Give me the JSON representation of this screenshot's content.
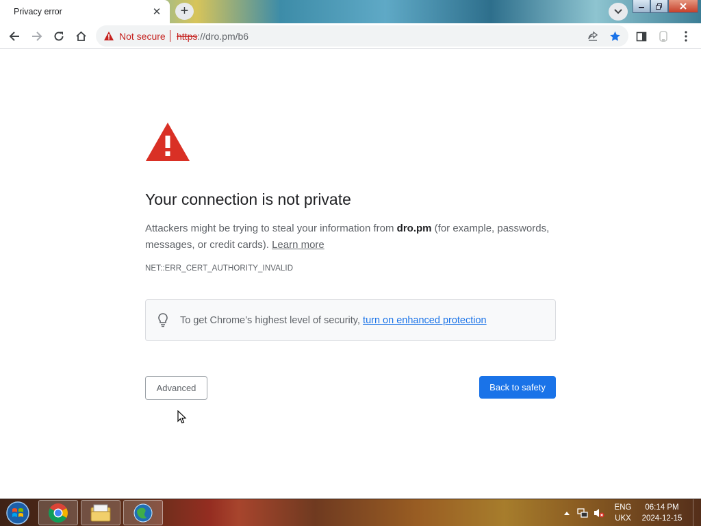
{
  "browser": {
    "tab": {
      "title": "Privacy error",
      "close_glyph": "✕"
    },
    "new_tab_glyph": "+",
    "toolbar": {
      "security_label": "Not secure",
      "url_scheme": "https",
      "url_rest": "://dro.pm/b6"
    },
    "icons": [
      "back-icon",
      "forward-icon",
      "reload-icon",
      "home-icon",
      "warning-icon",
      "share-icon",
      "bookmark-star-icon",
      "side-panel-icon",
      "extension-icon",
      "menu-icon"
    ]
  },
  "page": {
    "heading": "Your connection is not private",
    "explain_before": "Attackers might be trying to steal your information from ",
    "explain_domain": "dro.pm",
    "explain_after": " (for example, passwords, messages, or credit cards). ",
    "learn_more": "Learn more",
    "error_code": "NET::ERR_CERT_AUTHORITY_INVALID",
    "enhanced_text": "To get Chrome’s highest level of security, ",
    "enhanced_link": "turn on enhanced protection",
    "advanced_button": "Advanced",
    "back_button": "Back to safety"
  },
  "taskbar": {
    "apps": [
      "chrome",
      "file-explorer",
      "app"
    ],
    "language_top": "ENG",
    "language_bottom": "UKX",
    "time": "06:14 PM",
    "date": "2024-12-15"
  },
  "colors": {
    "warning_red": "#d93025",
    "link_blue": "#1a73e8",
    "primary_button": "#1a73e8",
    "not_secure_red": "#c5221f"
  }
}
